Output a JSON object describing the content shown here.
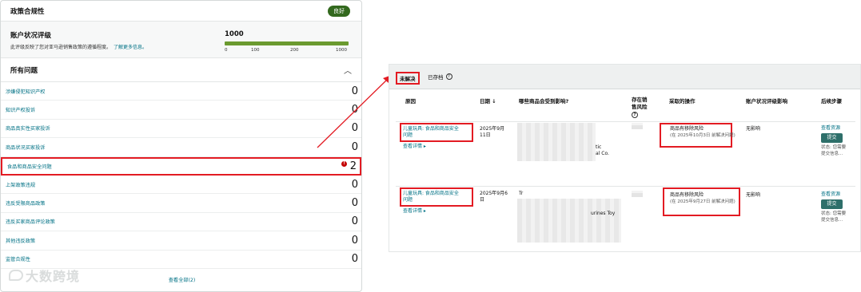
{
  "left_panel": {
    "title": "政策合规性",
    "badge": "良好",
    "rating_label": "账户状况评级",
    "rating_desc": "此评级反映了您对亚马逊销售政策的遵循程度。",
    "learn_more": "了解更多信息。",
    "score": "1000",
    "score_fraction": 1.0,
    "ticks": [
      "0",
      "100",
      "200",
      "1000"
    ],
    "issues_title": "所有问题",
    "issues": [
      {
        "label": "涉嫌侵犯知识产权",
        "count": "0"
      },
      {
        "label": "知识产权投诉",
        "count": "0"
      },
      {
        "label": "商品真实性买家投诉",
        "count": "0"
      },
      {
        "label": "商品状况买家投诉",
        "count": "0"
      },
      {
        "label": "食品和商品安全问题",
        "count": "2"
      },
      {
        "label": "上架政策违规",
        "count": "0"
      },
      {
        "label": "违反受限商品政策",
        "count": "0"
      },
      {
        "label": "违反买家商品评论政策",
        "count": "0"
      },
      {
        "label": "其他违反政策",
        "count": "0"
      },
      {
        "label": "监管合规性",
        "count": "0"
      }
    ],
    "see_all": "查看全部(2)",
    "watermark": "大数跨境"
  },
  "right_panel": {
    "tabs": {
      "unsolved": "未解决",
      "archived": "已存档"
    },
    "columns": {
      "reason": "原因",
      "date": "日期",
      "affected": "哪些商品会受到影响?",
      "risk_l1": "存在销",
      "risk_l2": "售风险",
      "action": "采取的操作",
      "impact": "账户状况评级影响",
      "next": "后续步骤"
    },
    "rows": [
      {
        "reason_l1": "儿童玩具: 食品和商品安全",
        "reason_l2": "问题",
        "view": "查看详情",
        "date_l1": "2025年9月",
        "date_l2": "11日",
        "product_fragment_1": "tic",
        "product_fragment_2": "al Co.",
        "action_l1": "商品有移除风险",
        "action_l2": "(在 2025年10月3日 前解决问题)",
        "impact": "无影响",
        "resource": "查看资源",
        "submit": "提交",
        "note_l1": "状态: 您需要",
        "note_l2": "提交信息..."
      },
      {
        "reason_l1": "儿童玩具: 食品和商品安全",
        "reason_l2": "问题",
        "view": "查看详情",
        "date_l1": "2025年9月6",
        "date_l2": "日",
        "product_fragment_1": "Tr",
        "product_fragment_2": "urines Toy",
        "action_l1": "商品有移除风险",
        "action_l2": "(在 2025年9月27日 前解决问题)",
        "impact": "无影响",
        "resource": "查看资源",
        "submit": "提交",
        "note_l1": "状态: 您需要",
        "note_l2": "提交信息..."
      }
    ]
  },
  "accent_colors": {
    "highlight": "#e31b23",
    "link": "#007185",
    "good": "#33691e",
    "bar": "#6b9a2f",
    "button": "#2e6f6a"
  }
}
